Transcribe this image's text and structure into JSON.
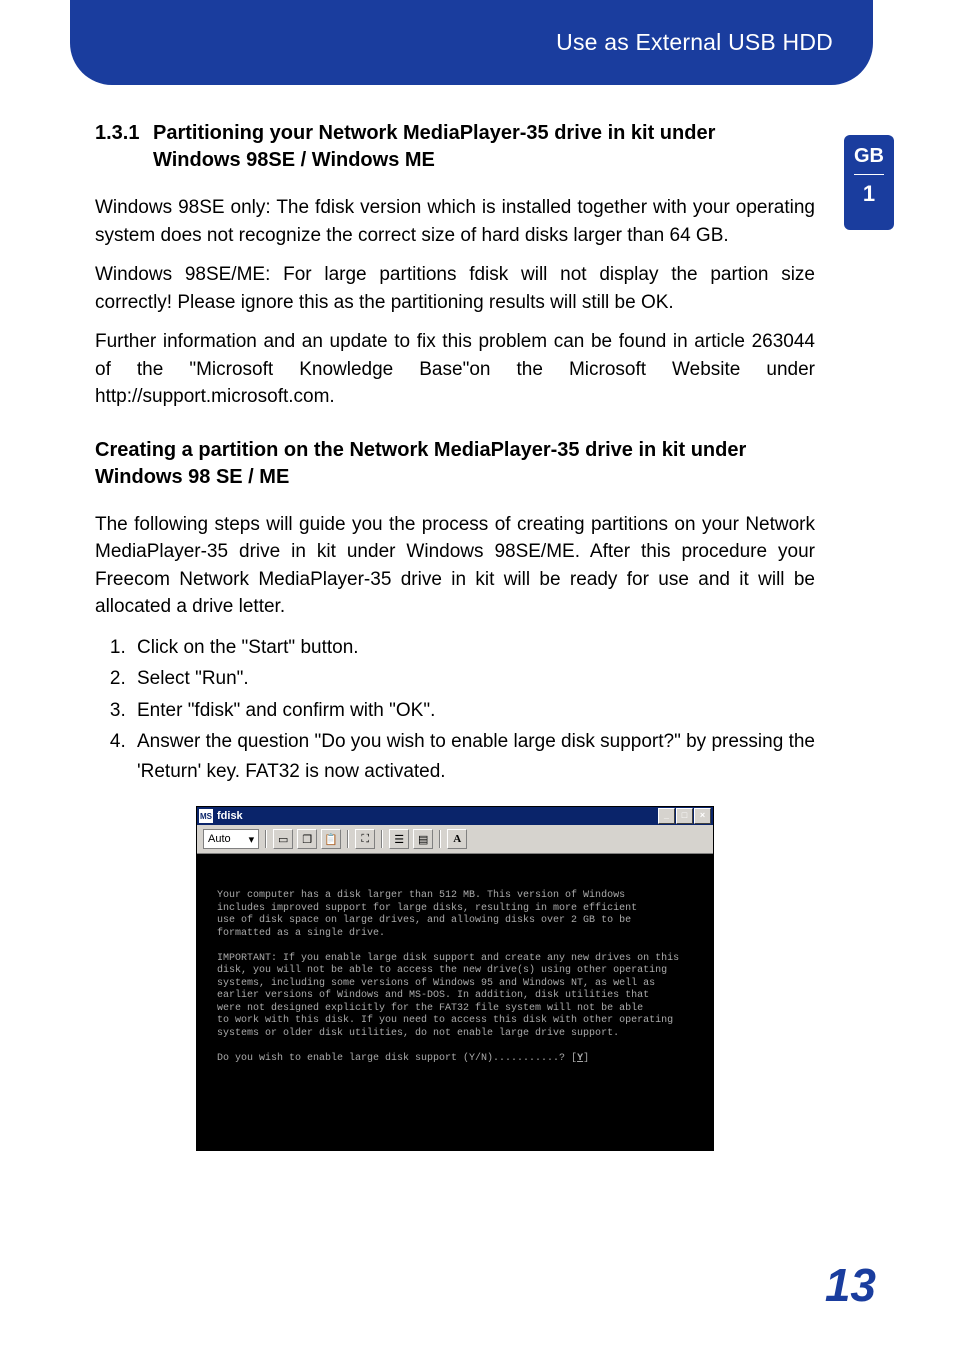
{
  "header": {
    "title": "Use as External USB HDD"
  },
  "sidetab": {
    "lang": "GB",
    "chapter": "1"
  },
  "section": {
    "number": "1.3.1",
    "title": "Partitioning your Network MediaPlayer-35 drive in kit under Windows 98SE / Windows ME"
  },
  "paragraphs": {
    "p1": "Windows 98SE only: The fdisk version which is installed together with your operating system does not recognize the correct size of hard disks larger than 64 GB.",
    "p2": "Windows 98SE/ME: For large partitions fdisk will not display the partion size correctly! Please ignore this as the partitioning results will still be OK.",
    "p3": "Further information and an update to fix this problem can be found in article 263044 of the \"Microsoft Knowledge Base\"on the Microsoft Website under http://support.microsoft.com."
  },
  "subheading": "Creating a partition on the Network MediaPlayer-35 drive in kit under Windows 98 SE / ME",
  "intro": "The following steps will guide you the process of creating partitions on your Network MediaPlayer-35 drive in kit under Windows 98SE/ME. After this procedure your Freecom Network MediaPlayer-35 drive in kit will be ready for use and it will be allocated a drive letter.",
  "steps": [
    "Click on the \"Start\" button.",
    "Select \"Run\".",
    "Enter \"fdisk\" and confirm with \"OK\".",
    "Answer the question \"Do you wish to enable large disk support?\" by pressing the 'Return' key. FAT32 is now activated."
  ],
  "fdisk": {
    "title": "fdisk",
    "toolbar_select": "Auto",
    "toolbar_font_btn": "A",
    "win_btns": {
      "min": "_",
      "max": "□",
      "close": "×"
    },
    "term_p1": "Your computer has a disk larger than 512 MB. This version of Windows\nincludes improved support for large disks, resulting in more efficient\nuse of disk space on large drives, and allowing disks over 2 GB to be\nformatted as a single drive.",
    "term_p2": "IMPORTANT: If you enable large disk support and create any new drives on this\ndisk, you will not be able to access the new drive(s) using other operating\nsystems, including some versions of Windows 95 and Windows NT, as well as\nearlier versions of Windows and MS-DOS. In addition, disk utilities that\nwere not designed explicitly for the FAT32 file system will not be able\nto work with this disk. If you need to access this disk with other operating\nsystems or older disk utilities, do not enable large drive support.",
    "term_prompt_pre": "Do you wish to enable large disk support (Y/N)...........? [",
    "term_prompt_key": "Y",
    "term_prompt_post": "]"
  },
  "page_number": "13"
}
